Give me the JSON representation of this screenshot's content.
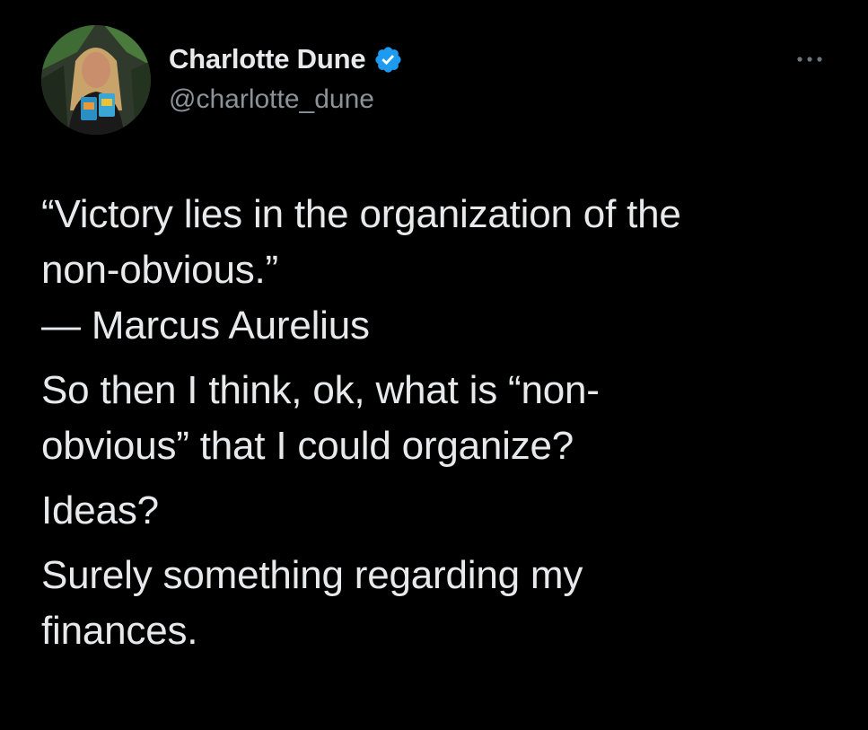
{
  "author": {
    "display_name": "Charlotte Dune",
    "handle": "@charlotte_dune",
    "verified": true,
    "avatar_icon": "profile-photo"
  },
  "menu": {
    "icon": "more-options-icon"
  },
  "tweet": {
    "quote_line1": "“Victory lies in the organization of the",
    "quote_line2": "non-obvious.”",
    "attribution": "— Marcus Aurelius",
    "para2_line1": "So then I think, ok, what is “non-",
    "para2_line2": "obvious” that I could organize?",
    "para3": "Ideas?",
    "para4_line1": "Surely something regarding my",
    "para4_line2": "finances."
  },
  "colors": {
    "background": "#000000",
    "text_primary": "#e7e9ea",
    "text_secondary": "#8b9298",
    "verified_blue": "#1d9bf0"
  }
}
